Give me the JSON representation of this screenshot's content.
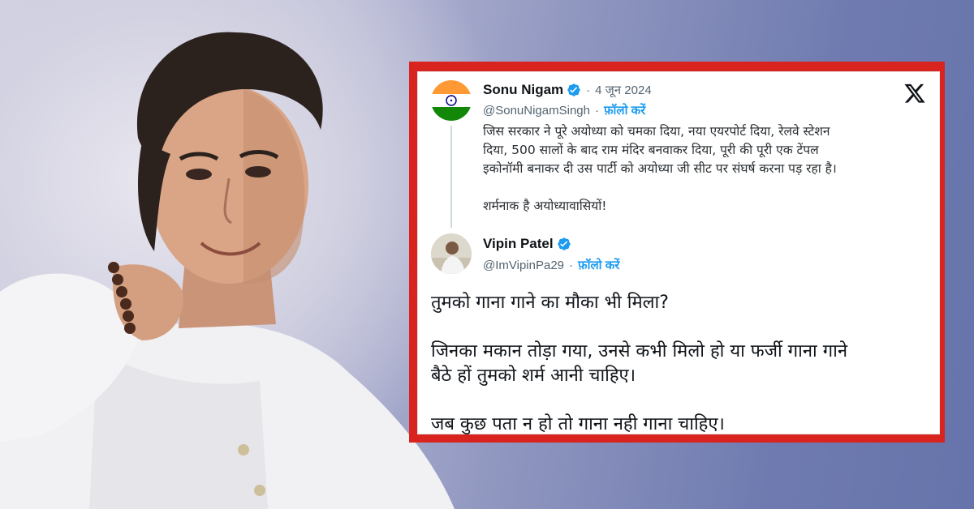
{
  "colors": {
    "card_border_accent": "#d8231f",
    "link_blue": "#1d9bf0",
    "verified_blue": "#1d9bf0",
    "muted_text": "#536471"
  },
  "photo": {
    "subject": "man-portrait-white-kurta"
  },
  "card": {
    "platform_icon": "x-logo-icon",
    "original_tweet": {
      "author_name": "Sonu Nigam",
      "handle": "@SonuNigamSingh",
      "separator": "·",
      "date": "4 जून 2024",
      "follow_label": "फ़ॉलो करें",
      "avatar_icon": "india-flag-avatar",
      "text_lines": [
        "जिस सरकार ने पूरे अयोध्या को चमका दिया, नया एयरपोर्ट दिया, रेलवे स्टेशन",
        "दिया, 500 सालों के बाद राम मंदिर बनवाकर दिया, पूरी की पूरी एक टेंपल",
        "इकोनॉमी बनाकर दी उस पार्टी को अयोध्या जी सीट पर संघर्ष करना पड़ रहा है।",
        "शर्मनाक है अयोध्यावासियों!"
      ]
    },
    "reply_tweet": {
      "author_name": "Vipin Patel",
      "handle": "@ImVipinPa29",
      "separator": "·",
      "follow_label": "फ़ॉलो करें",
      "avatar_icon": "user-photo-avatar",
      "text_lines": [
        "तुमको गाना गाने का मौका भी मिला?",
        "जिनका मकान तोड़ा गया, उनसे कभी मिलो हो या फर्जी गाना गाने",
        "बैठे हों तुमको शर्म आनी चाहिए।",
        "जब कुछ पता न हो तो गाना नही गाना चाहिए।"
      ]
    }
  }
}
